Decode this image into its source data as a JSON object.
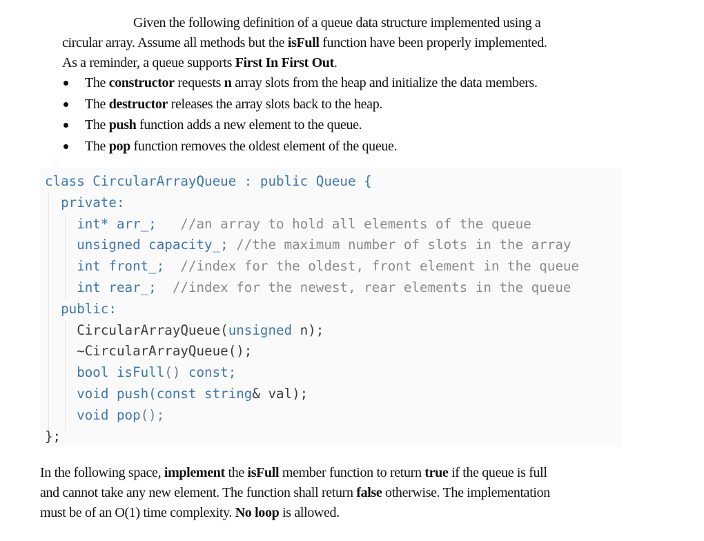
{
  "intro": {
    "segments": [
      {
        "text": "Given the following definition of a queue data structure implemented using a circular array. Assume all methods but the ",
        "bold": false
      },
      {
        "text": "isFull",
        "bold": true
      },
      {
        "text": " function have been properly implemented. As a reminder, a queue supports ",
        "bold": false
      },
      {
        "text": "First In First Out",
        "bold": true
      },
      {
        "text": ".",
        "bold": false
      }
    ],
    "line1": "Given the following definition of a queue data structure implemented using a",
    "line2_a": "circular array. Assume all methods but the ",
    "line2_b": "isFull",
    "line2_c": " function have been properly implemented.",
    "line3_a": "As a reminder, a queue supports ",
    "line3_b": "First In First Out",
    "line3_c": "."
  },
  "bullets": [
    {
      "pre": "The ",
      "bold": "constructor",
      "mid": " requests ",
      "bold2": "n",
      "post": " array slots from the heap and initialize the data members."
    },
    {
      "pre": "The ",
      "bold": "destructor",
      "mid": "",
      "bold2": "",
      "post": " releases the array slots back to the heap."
    },
    {
      "pre": "The ",
      "bold": "push",
      "mid": "",
      "bold2": "",
      "post": " function adds a new element to the queue."
    },
    {
      "pre": "The ",
      "bold": "pop",
      "mid": "",
      "bold2": "",
      "post": " function removes the oldest element of the queue."
    }
  ],
  "code": {
    "lines": [
      {
        "parts": [
          {
            "t": "class CircularArrayQueue : public Queue {",
            "c": ""
          }
        ]
      },
      {
        "parts": [
          {
            "t": "  private:",
            "c": ""
          }
        ]
      },
      {
        "parts": [
          {
            "t": "    int* arr_;   ",
            "c": ""
          },
          {
            "t": "//an array to hold all elements of the queue",
            "c": "c-com"
          }
        ]
      },
      {
        "parts": [
          {
            "t": "    unsigned capacity_; ",
            "c": ""
          },
          {
            "t": "//the maximum number of slots in the array",
            "c": "c-com"
          }
        ]
      },
      {
        "parts": [
          {
            "t": "    int front_;  ",
            "c": ""
          },
          {
            "t": "//index for the oldest, front element in the queue",
            "c": "c-com"
          }
        ]
      },
      {
        "parts": [
          {
            "t": "    int rear_;  ",
            "c": ""
          },
          {
            "t": "//index for the newest, rear elements in the queue",
            "c": "c-com"
          }
        ]
      },
      {
        "parts": [
          {
            "t": "  public:",
            "c": ""
          }
        ]
      },
      {
        "parts": [
          {
            "t": "    CircularArrayQueue(",
            "c": "c-dark"
          },
          {
            "t": "unsigned",
            "c": ""
          },
          {
            "t": " n);",
            "c": "c-dark"
          }
        ]
      },
      {
        "parts": [
          {
            "t": "    ~CircularArrayQueue();",
            "c": "c-dark"
          }
        ]
      },
      {
        "parts": [
          {
            "t": "    bool isFull",
            "c": ""
          },
          {
            "t": "()",
            "c": "c-punc"
          },
          {
            "t": " const;",
            "c": ""
          }
        ]
      },
      {
        "parts": [
          {
            "t": "    void push(const string",
            "c": ""
          },
          {
            "t": "& val);",
            "c": "c-dark"
          }
        ]
      },
      {
        "parts": [
          {
            "t": "    void pop",
            "c": ""
          },
          {
            "t": "();",
            "c": "c-punc"
          }
        ]
      },
      {
        "parts": [
          {
            "t": "};",
            "c": "c-dark"
          }
        ]
      }
    ]
  },
  "outro": {
    "line1_parts": [
      {
        "text": "In the following space, ",
        "bold": false
      },
      {
        "text": "implement",
        "bold": true
      },
      {
        "text": " the ",
        "bold": false
      },
      {
        "text": "isFull",
        "bold": true
      },
      {
        "text": " member function to return ",
        "bold": false
      },
      {
        "text": "true",
        "bold": true
      },
      {
        "text": " if the queue is full",
        "bold": false
      }
    ],
    "line2_parts": [
      {
        "text": "and cannot take any new element. The function shall return ",
        "bold": false
      },
      {
        "text": "false",
        "bold": true
      },
      {
        "text": " otherwise. The implementation",
        "bold": false
      }
    ],
    "line3_parts": [
      {
        "text": "must be of an O(1) time complexity. ",
        "bold": false
      },
      {
        "text": "No loop",
        "bold": true
      },
      {
        "text": " is allowed.",
        "bold": false
      }
    ]
  }
}
